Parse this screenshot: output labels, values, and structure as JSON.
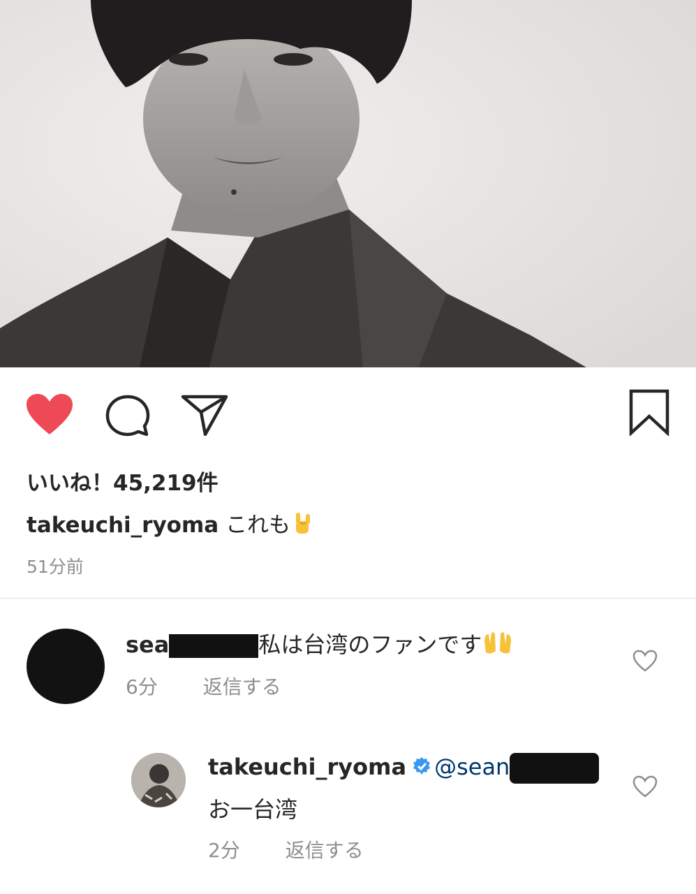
{
  "post": {
    "likes_text": "いいね！45,219件",
    "caption_user": "takeuchi_ryoma",
    "caption_text": "これも",
    "caption_emoji": "sign-of-the-horns-emoji",
    "time": "51分前"
  },
  "icons": {
    "like": "heart-icon-filled",
    "comment": "comment-icon",
    "share": "send-icon",
    "save": "bookmark-icon"
  },
  "colors": {
    "like_red": "#ed4956",
    "text": "#262626",
    "muted": "#8e8e8e",
    "mention": "#00376b",
    "verified_blue": "#3897f0"
  },
  "comments": [
    {
      "user_visible": "sea",
      "text": "私は台湾のファンです",
      "emoji": "raising-hands-emoji",
      "time": "6分",
      "reply_label": "返信する"
    },
    {
      "user": "takeuchi_ryoma",
      "mention": "@sean",
      "text": "お一台湾",
      "time": "2分",
      "reply_label": "返信する"
    }
  ]
}
